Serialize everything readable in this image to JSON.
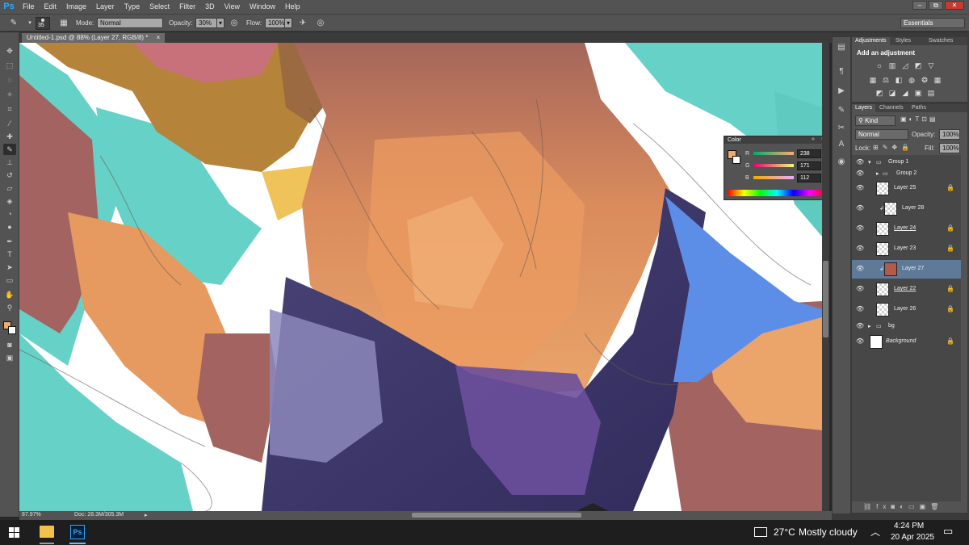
{
  "app": {
    "logo": "Ps"
  },
  "menu": [
    "File",
    "Edit",
    "Image",
    "Layer",
    "Type",
    "Select",
    "Filter",
    "3D",
    "View",
    "Window",
    "Help"
  ],
  "window_controls": {
    "minimize": "–",
    "restore": "⧉",
    "close": "✕"
  },
  "options": {
    "brush_size": "35",
    "mode_label": "Mode:",
    "mode_value": "Normal",
    "opacity_label": "Opacity:",
    "opacity_value": "30%",
    "flow_label": "Flow:",
    "flow_value": "100%",
    "workspace": "Essentials"
  },
  "document": {
    "tab_title": "Untitled-1.psd @ 88% (Layer 27, RGB/8) *",
    "tab_close": "×",
    "zoom": "87.97%",
    "doc_size": "Doc: 28.3M/305.3M"
  },
  "adjustments_panel": {
    "tabs": [
      "Adjustments",
      "Styles",
      "Swatches"
    ],
    "heading": "Add an adjustment"
  },
  "color_panel": {
    "title": "Color",
    "r_label": "R",
    "r_value": "238",
    "g_label": "G",
    "g_value": "171",
    "b_label": "B",
    "b_value": "112",
    "foreground": "#eeab70"
  },
  "layers_panel": {
    "tabs": [
      "Layers",
      "Channels",
      "Paths"
    ],
    "kind_label": "Kind",
    "blend_mode": "Normal",
    "opacity_label": "Opacity:",
    "opacity_value": "100%",
    "lock_label": "Lock:",
    "fill_label": "Fill:",
    "fill_value": "100%",
    "layers": [
      {
        "name": "Group 1",
        "type": "group",
        "expanded": true
      },
      {
        "name": "Group 2",
        "type": "group",
        "expanded": false
      },
      {
        "name": "Layer 25",
        "type": "layer",
        "locked": true
      },
      {
        "name": "Layer 28",
        "type": "layer",
        "clipped": true
      },
      {
        "name": "Layer 24",
        "type": "layer",
        "locked": true
      },
      {
        "name": "Layer 23",
        "type": "layer",
        "locked": true
      },
      {
        "name": "Layer 27",
        "type": "layer",
        "clipped": true,
        "selected": true
      },
      {
        "name": "Layer 22",
        "type": "layer",
        "locked": true
      },
      {
        "name": "Layer 26",
        "type": "layer",
        "locked": true
      },
      {
        "name": "bg",
        "type": "group",
        "expanded": false
      },
      {
        "name": "Background",
        "type": "background",
        "locked": true
      }
    ]
  },
  "taskbar": {
    "weather_temp": "27°C",
    "weather_text": "Mostly cloudy",
    "time": "4:24 PM",
    "date": "20 Apr 2025"
  },
  "colors": {
    "canvas_teal": "#66d1c7",
    "skin_light": "#eba46a",
    "skin_dark": "#a36461",
    "cloth_navy": "#3f3a6e",
    "cloth_blue": "#5c8ee8",
    "hair_gold": "#b5843a"
  }
}
